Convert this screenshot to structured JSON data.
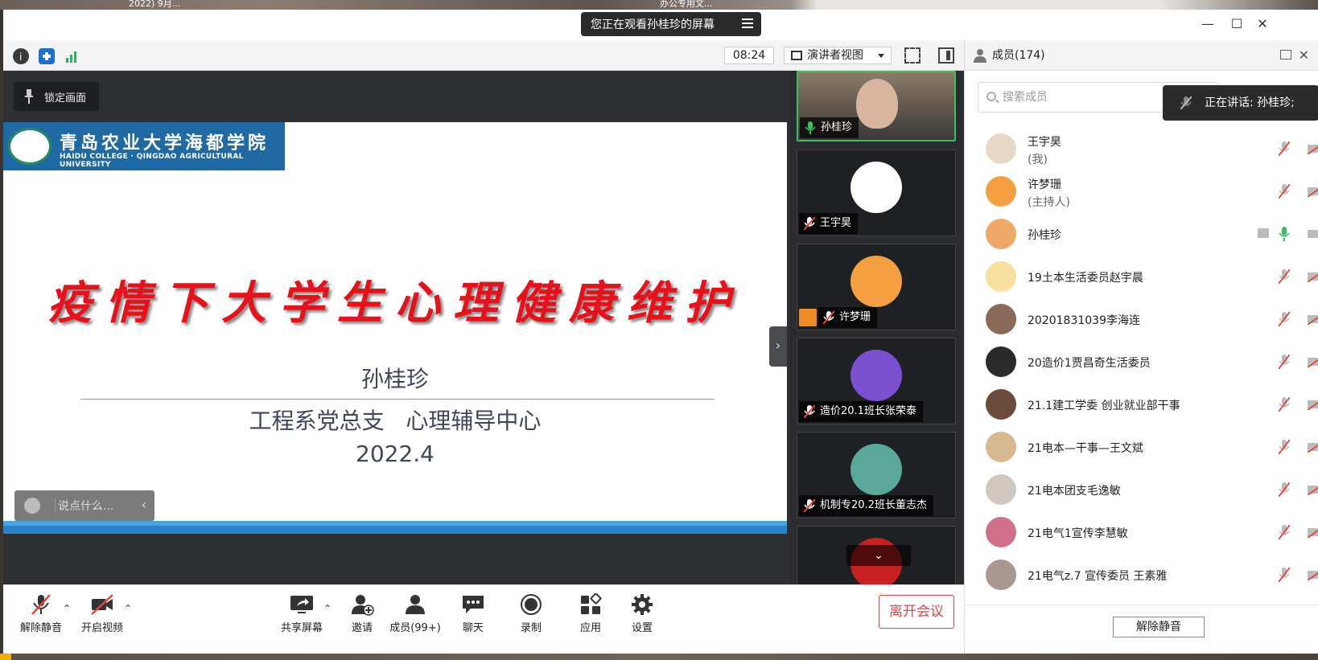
{
  "desktop": {
    "top_text_left": "2022)  9月...",
    "top_text_right": "办公专用文..."
  },
  "banner": {
    "text": "您正在观看孙桂珍的屏幕"
  },
  "window_controls": {
    "minimize": "—",
    "maximize": "☐",
    "close": "✕"
  },
  "toolbar": {
    "timer": "08:24",
    "view_mode": "演讲者视图"
  },
  "share": {
    "lock_label": "锁定画面",
    "chat_placeholder": "说点什么...",
    "slide": {
      "logo_cn": "青岛农业大学海都学院",
      "logo_en": "HAIDU COLLEGE · QINGDAO AGRICULTURAL UNIVERSITY",
      "title": "疫情下大学生心理健康维护",
      "author": "孙桂珍",
      "department": "工程系党总支   心理辅导中心",
      "date": "2022.4"
    }
  },
  "video_tiles": [
    {
      "name": "孙桂珍",
      "active": true,
      "mic": "on"
    },
    {
      "name": "王宇昊",
      "mic": "muted",
      "avatar_color": "#ffffff"
    },
    {
      "name": "许梦珊",
      "mic": "muted",
      "host": true,
      "avatar_color": "#f4a040"
    },
    {
      "name": "造价20.1班长张荣泰",
      "mic": "muted",
      "avatar_color": "#7a4fd0"
    },
    {
      "name": "机制专20.2班长董志杰",
      "mic": "muted",
      "avatar_color": "#5aa89a"
    }
  ],
  "bottom_bar": {
    "unmute": "解除静音",
    "start_video": "开启视频",
    "share_screen": "共享屏幕",
    "invite": "邀请",
    "members": "成员(99+)",
    "chat": "聊天",
    "record": "录制",
    "apps": "应用",
    "settings": "设置",
    "leave": "离开会议"
  },
  "members_panel": {
    "title": "成员(174)",
    "search_placeholder": "搜索成员",
    "speaking": "正在讲话: 孙桂珍;",
    "unmute_all": "解除静音",
    "members": [
      {
        "name": "王宇昊",
        "role": "(我)",
        "avatar_color": "#e8d8c8"
      },
      {
        "name": "许梦珊",
        "role": "(主持人)",
        "avatar_color": "#f4a040"
      },
      {
        "name": "孙桂珍",
        "role": "",
        "avatar_color": "#f0a868",
        "speaking": true
      },
      {
        "name": "19土本生活委员赵宇晨",
        "role": "",
        "avatar_color": "#f8e0a0"
      },
      {
        "name": "20201831039李海连",
        "role": "",
        "avatar_color": "#8a6a58"
      },
      {
        "name": "20造价1贾昌奇生活委员",
        "role": "",
        "avatar_color": "#2a2a2a"
      },
      {
        "name": "21.1建工学委  创业就业部干事",
        "role": "",
        "avatar_color": "#6a4a3a"
      },
      {
        "name": "21电本—干事—王文斌",
        "role": "",
        "avatar_color": "#d8b890"
      },
      {
        "name": "21电本团支毛逸敏",
        "role": "",
        "avatar_color": "#d0c8c0"
      },
      {
        "name": "21电气1宣传李慧敏",
        "role": "",
        "avatar_color": "#d0708a"
      },
      {
        "name": "21电气z.7 宣传委员 王素雅",
        "role": "",
        "avatar_color": "#a89890"
      }
    ]
  },
  "colors": {
    "accent_red": "#e64340",
    "speaking_green": "#3bbf63",
    "slide_title_red": "#e8101a",
    "slide_blue": "#2a82c8"
  }
}
